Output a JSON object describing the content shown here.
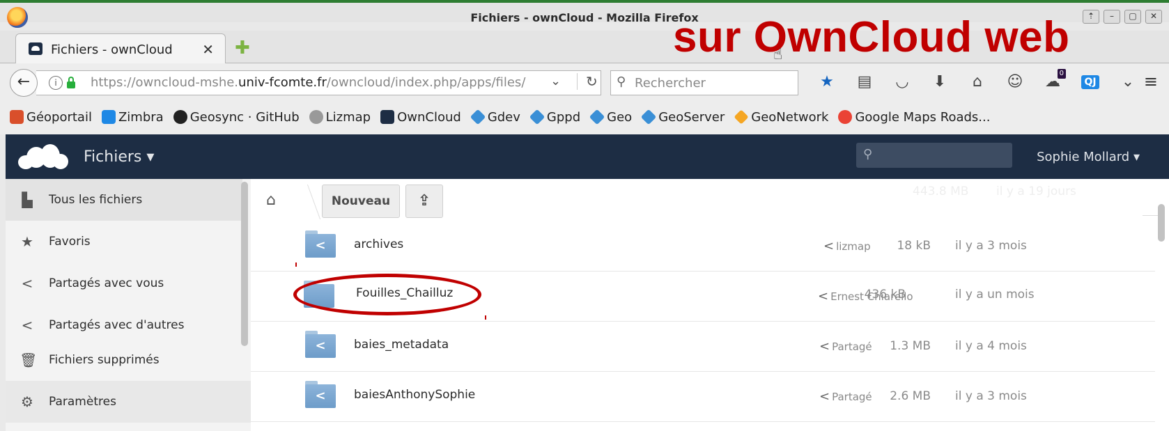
{
  "window": {
    "title": "Fichiers - ownCloud - Mozilla Firefox",
    "controls": [
      "⇡",
      "–",
      "▢",
      "✕"
    ]
  },
  "overlay_text": "sur OwnCloud web",
  "tab": {
    "label": "Fichiers - ownCloud",
    "close": "✕",
    "new_tab": "✚"
  },
  "navbar": {
    "back": "←",
    "url_prefix": "https://owncloud-mshe.",
    "url_domain": "univ-fcomte.fr",
    "url_suffix": "/owncloud/index.php/apps/files/",
    "dropdown": "⌄",
    "reload": "↻",
    "search_placeholder": "Rechercher",
    "notification_count": "0",
    "qj_label": "QJ",
    "menu": "≡",
    "icons": [
      "star-icon",
      "reader-icon",
      "pocket-icon",
      "download-icon",
      "home-icon",
      "chat-icon",
      "ghost-notify-icon",
      "qj-extension-icon",
      "more-icon"
    ]
  },
  "bookmarks": [
    {
      "label": "Géoportail",
      "color": "#d94f2b"
    },
    {
      "label": "Zimbra",
      "color": "#1e88e5"
    },
    {
      "label": "Geosync · GitHub",
      "color": "#222222"
    },
    {
      "label": "Lizmap",
      "color": "#777777"
    },
    {
      "label": "OwnCloud",
      "color": "#1d2d44"
    },
    {
      "label": "Gdev",
      "color": "#3a8fd6"
    },
    {
      "label": "Gppd",
      "color": "#3a8fd6"
    },
    {
      "label": "Geo",
      "color": "#3a8fd6"
    },
    {
      "label": "GeoServer",
      "color": "#3a8fd6"
    },
    {
      "label": "GeoNetwork",
      "color": "#f5a623"
    },
    {
      "label": "Google Maps Roads...",
      "color": "#ea4335"
    }
  ],
  "owncloud": {
    "app_name": "Fichiers ▾",
    "user": "Sophie Mollard ▾",
    "colors": {
      "header": "#1d2d44",
      "annotation": "#c00000"
    }
  },
  "sidebar": {
    "items": [
      {
        "label": "Tous les fichiers",
        "icon": "▙",
        "active": true
      },
      {
        "label": "Favoris",
        "icon": "★"
      },
      {
        "label": "Partagés avec vous",
        "icon": "<"
      },
      {
        "label": "Partagés avec d'autres",
        "icon": "<"
      },
      {
        "label": "Fichiers supprimés",
        "icon": "🗑"
      },
      {
        "label": "Paramètres",
        "icon": "⚙"
      }
    ]
  },
  "toolbar": {
    "home": "⌂",
    "new_label": "Nouveau",
    "upload": "⇪",
    "ghost_size": "443.8 MB",
    "ghost_date": "il y a 19 jours"
  },
  "files": [
    {
      "name": "archives",
      "shared_with": "lizmap",
      "size": "18 kB",
      "date": "il y a 3 mois",
      "shared_icon": true
    },
    {
      "name": "Fouilles_Chailluz",
      "shared_with": "Ernest Chiarello",
      "size": "436 kB",
      "date": "il y a un mois",
      "shared_icon": false
    },
    {
      "name": "baies_metadata",
      "shared_with": "Partagé",
      "size": "1.3 MB",
      "date": "il y a 4 mois",
      "shared_icon": true
    },
    {
      "name": "baiesAnthonySophie",
      "shared_with": "Partagé",
      "size": "2.6 MB",
      "date": "il y a 3 mois",
      "shared_icon": true
    }
  ]
}
